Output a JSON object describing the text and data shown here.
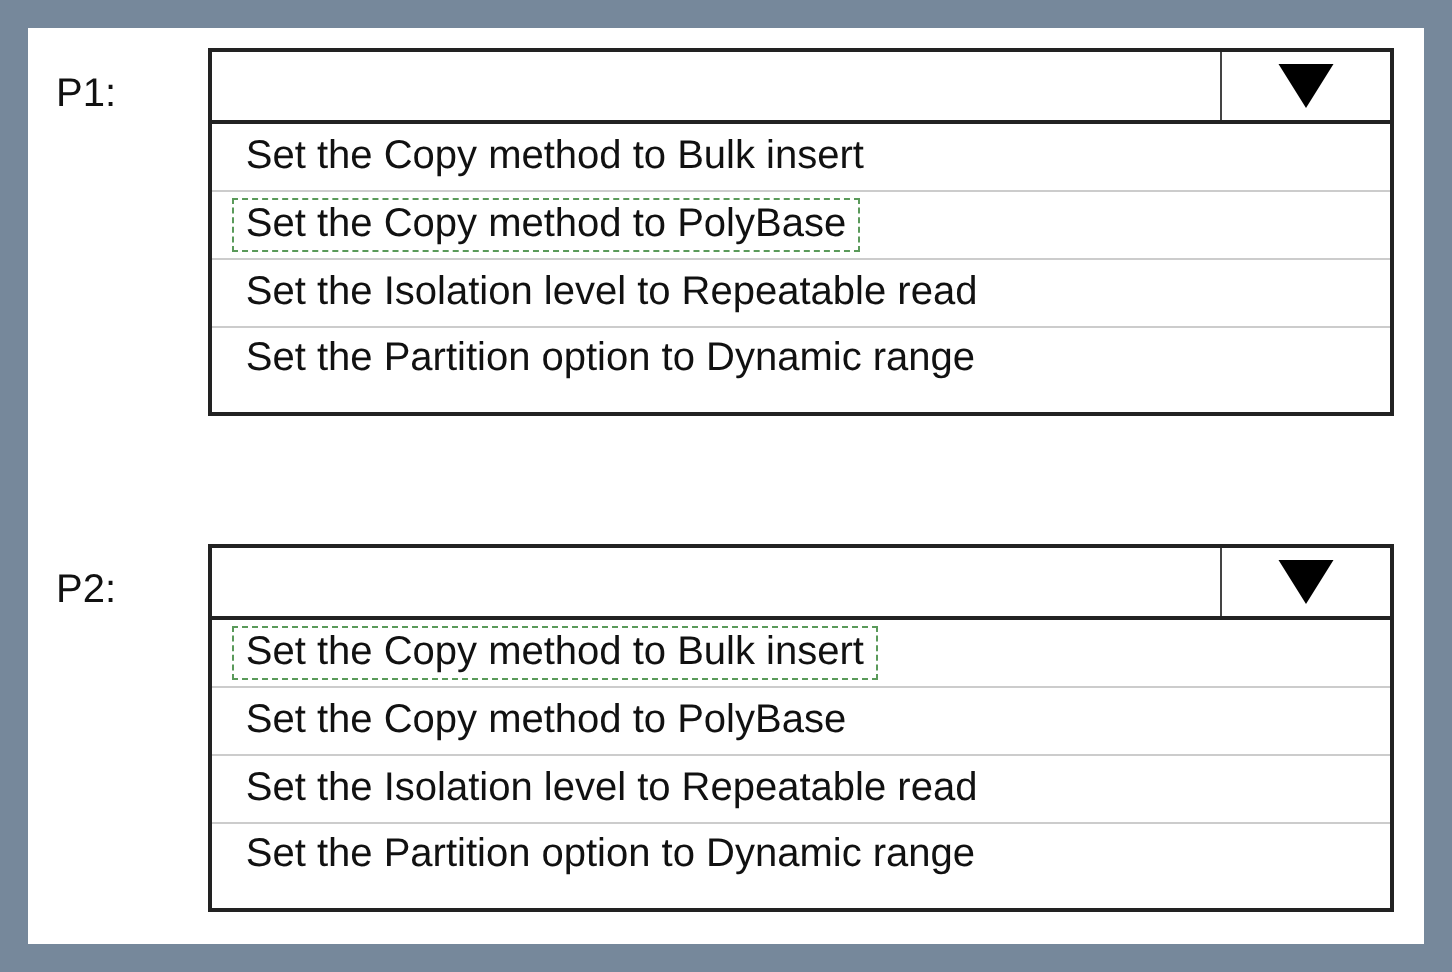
{
  "questions": [
    {
      "label": "P1:",
      "options": [
        {
          "text": "Set the Copy method to Bulk insert",
          "selected": false
        },
        {
          "text": "Set the Copy method to PolyBase",
          "selected": true
        },
        {
          "text": "Set the Isolation level to Repeatable read",
          "selected": false
        },
        {
          "text": "Set the Partition option to Dynamic range",
          "selected": false
        }
      ]
    },
    {
      "label": "P2:",
      "options": [
        {
          "text": "Set the Copy method to Bulk insert",
          "selected": true
        },
        {
          "text": "Set the Copy method to PolyBase",
          "selected": false
        },
        {
          "text": "Set the Isolation level to Repeatable read",
          "selected": false
        },
        {
          "text": "Set the Partition option to Dynamic range",
          "selected": false
        }
      ]
    }
  ]
}
